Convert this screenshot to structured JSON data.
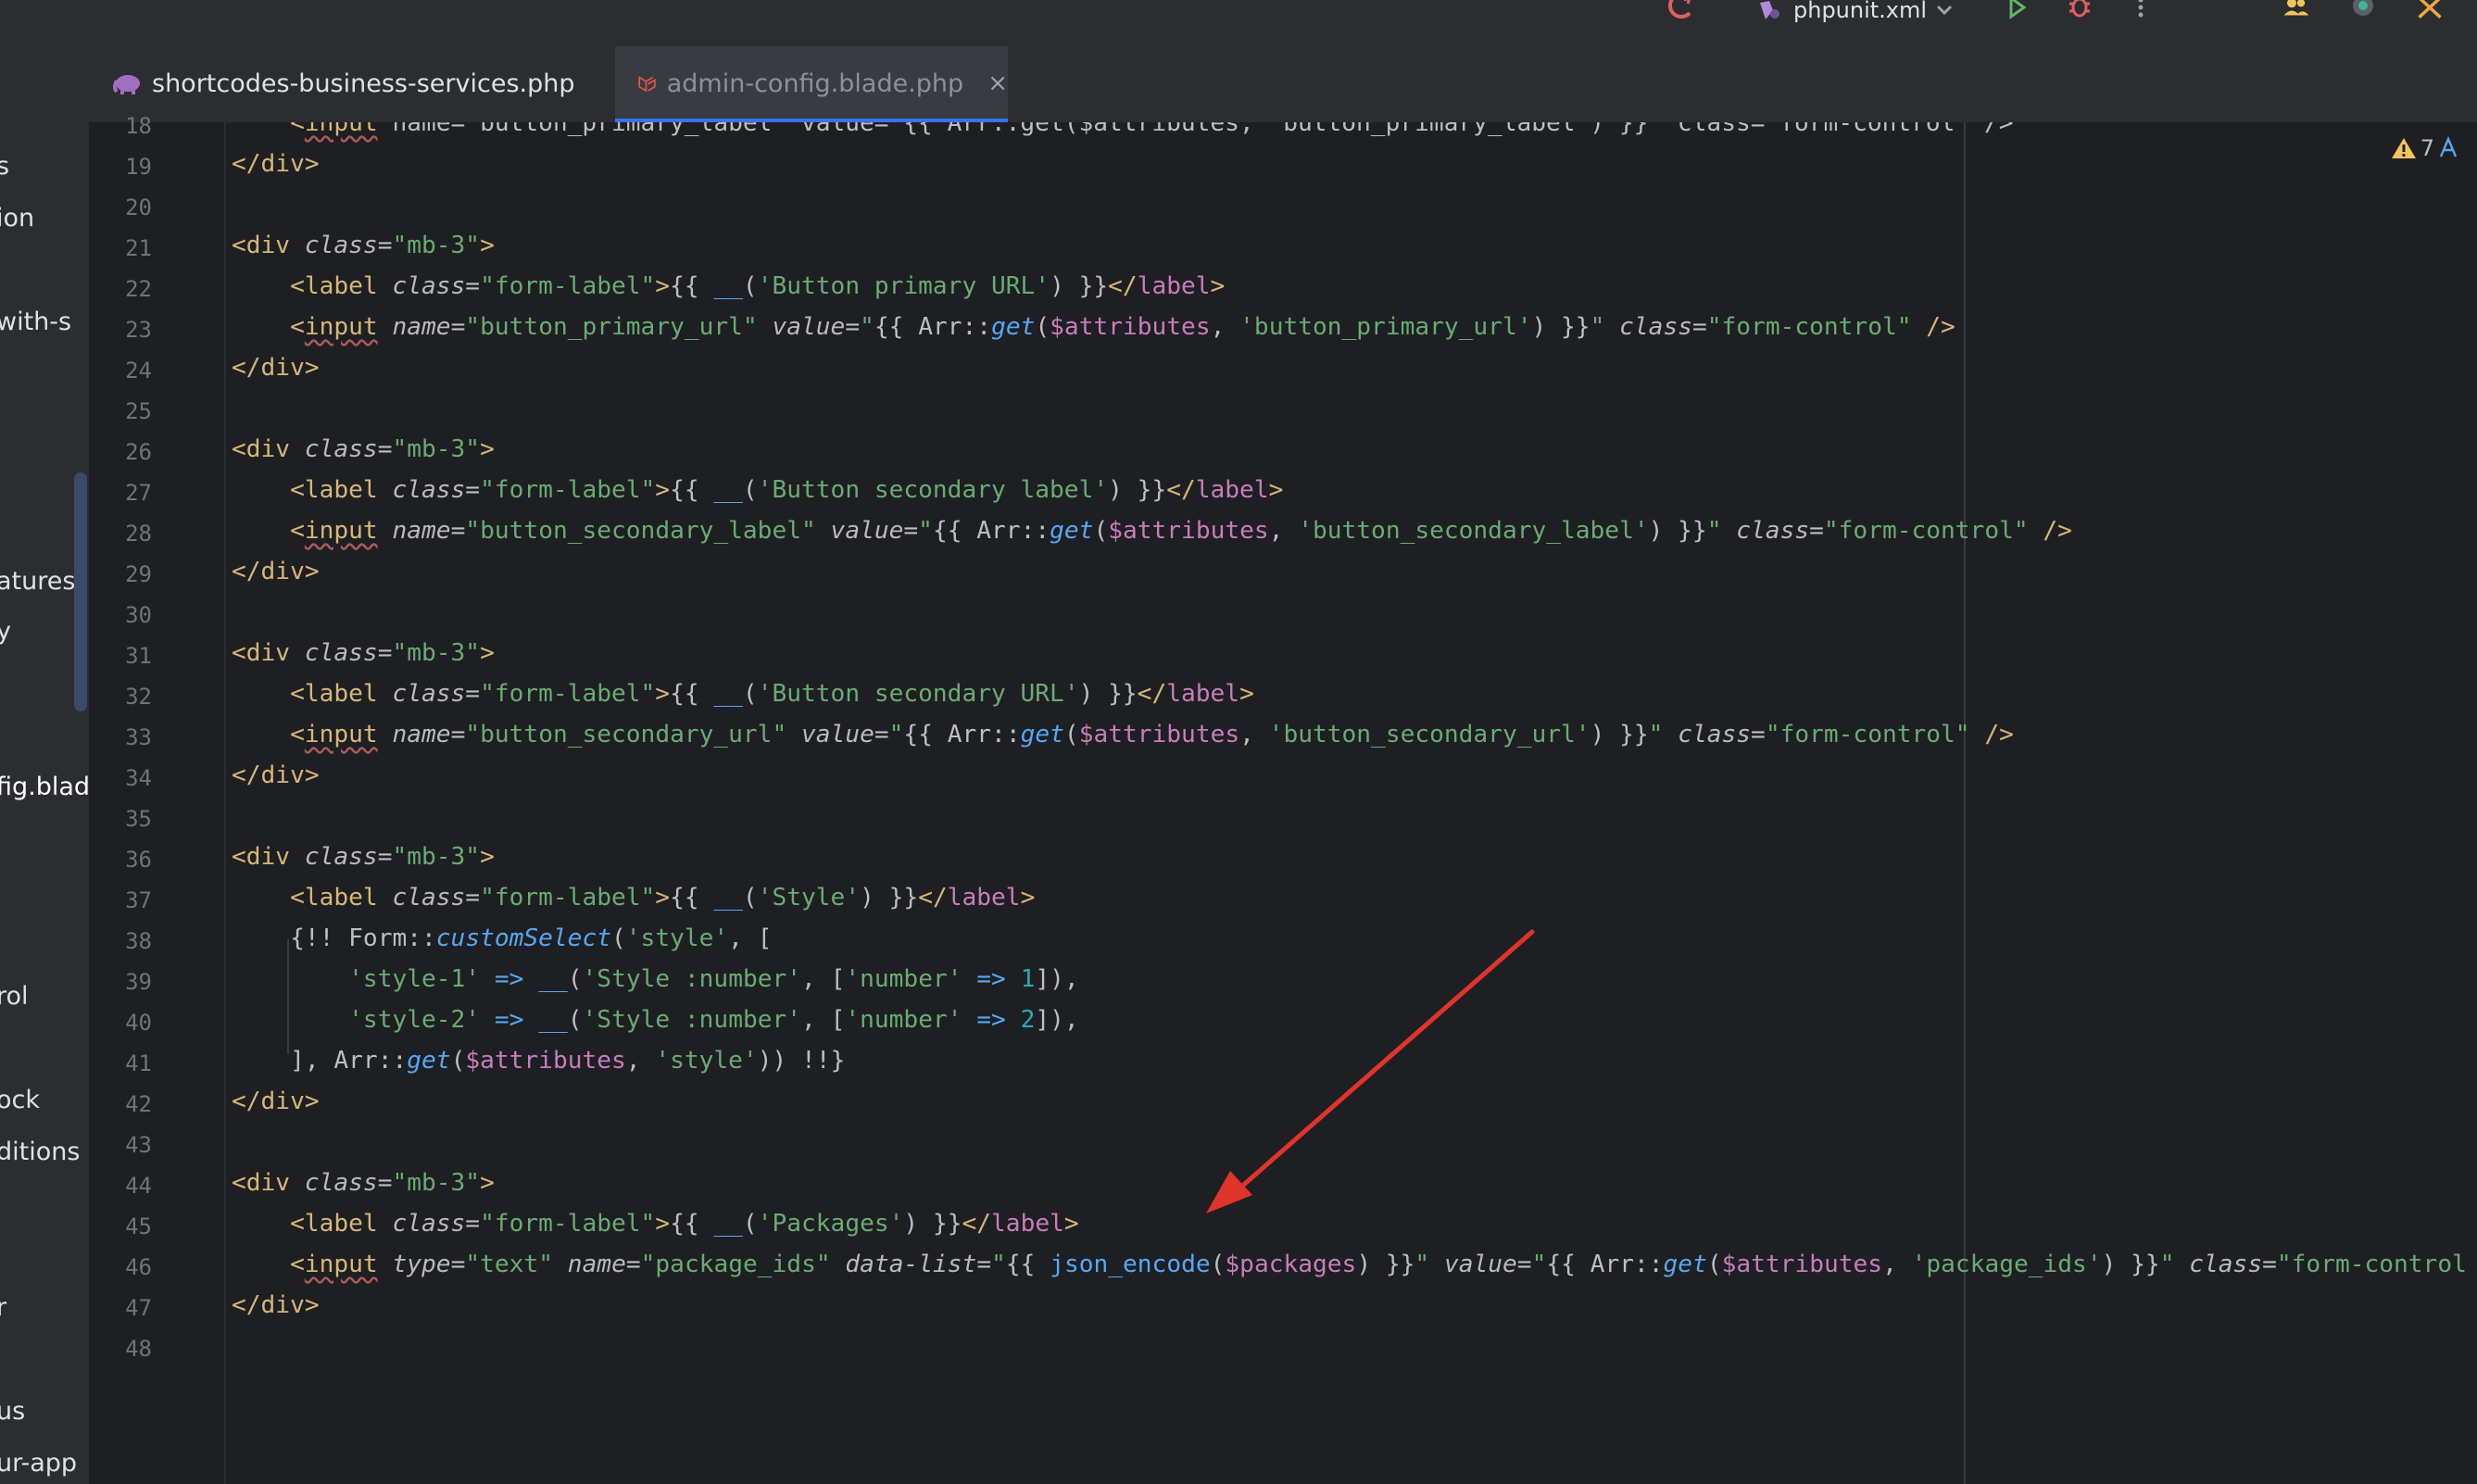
{
  "titlebar": {
    "run_config": "phpunit.xml"
  },
  "tabs": [
    {
      "label": "shortcodes-business-services.php",
      "active": false,
      "icon": "php-elephant-icon"
    },
    {
      "label": "admin-config.blade.php",
      "active": true,
      "icon": "laravel-blade-icon",
      "close": "×"
    }
  ],
  "sidebar_items": [
    {
      "text": "s"
    },
    {
      "text": "ion"
    },
    {
      "text": "with-s"
    },
    {
      "text": "atures"
    },
    {
      "text": "y"
    },
    {
      "text": "fig.blad",
      "active": true
    },
    {
      "text": "rol"
    },
    {
      "text": "ock"
    },
    {
      "text": "ditions"
    },
    {
      "text": "r"
    },
    {
      "text": "us"
    },
    {
      "text": "ur-app"
    }
  ],
  "inspection": {
    "count": "7"
  },
  "line_numbers": [
    "18",
    "19",
    "20",
    "21",
    "22",
    "23",
    "24",
    "25",
    "26",
    "27",
    "28",
    "29",
    "30",
    "31",
    "32",
    "33",
    "34",
    "35",
    "36",
    "37",
    "38",
    "39",
    "40",
    "41",
    "42",
    "43",
    "44",
    "45",
    "46",
    "47",
    "48"
  ],
  "code": {
    "l18_a": "<",
    "l18_tag": "input",
    "l18_b": " name=\"button_primary_label\" value=\"{{ Arr::get($attributes, 'button_primary_label') }}\" class=\"form-control\" />",
    "l19": "</div>",
    "l21": "<div class=\"mb-3\">",
    "l22_label": "Button primary URL",
    "l23_name": "button_primary_url",
    "l23_key": "button_primary_url",
    "l24": "</div>",
    "l26": "<div class=\"mb-3\">",
    "l27_label": "Button secondary label",
    "l28_name": "button_secondary_label",
    "l28_key": "button_secondary_label",
    "l29": "</div>",
    "l31": "<div class=\"mb-3\">",
    "l32_label": "Button secondary URL",
    "l33_name": "button_secondary_url",
    "l33_key": "button_secondary_url",
    "l34": "</div>",
    "l36": "<div class=\"mb-3\">",
    "l37_label": "Style",
    "l38_select": "style",
    "l39_key": "style-1",
    "l39_label": "Style :number",
    "l39_num": "1",
    "l40_key": "style-2",
    "l40_label": "Style :number",
    "l40_num": "2",
    "l41_key": "style",
    "l42": "</div>",
    "l44": "<div class=\"mb-3\">",
    "l45_label": "Packages",
    "l46_type": "text",
    "l46_name": "package_ids",
    "l46_var": "$packages",
    "l46_key": "package_ids",
    "l46_class": "form-control li",
    "l47": "</div>"
  },
  "colors": {
    "arrow": "#e0342a",
    "tag": "#d5b778",
    "string": "#6aab73",
    "variable": "#c77dbb",
    "function": "#56a8f5",
    "number": "#2aacb8",
    "accent": "#3574f0"
  }
}
